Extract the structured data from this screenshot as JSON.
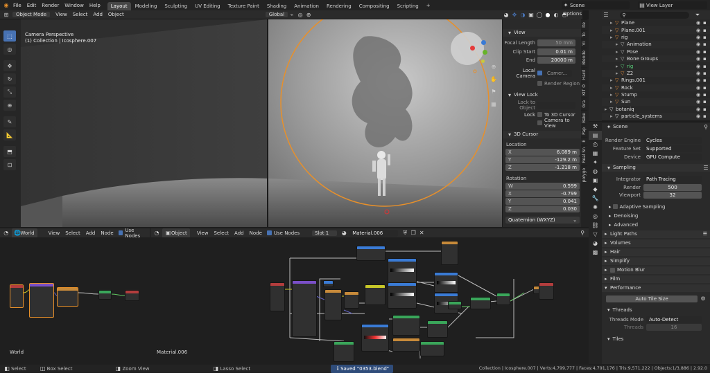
{
  "topbar": {
    "menus": [
      "File",
      "Edit",
      "Render",
      "Window",
      "Help"
    ],
    "workspaces": [
      "Layout",
      "Modeling",
      "Sculpting",
      "UV Editing",
      "Texture Paint",
      "Shading",
      "Animation",
      "Rendering",
      "Compositing",
      "Scripting"
    ],
    "active_workspace": "Layout",
    "add_tab": "+",
    "scene": "Scene",
    "view_layer": "View Layer"
  },
  "viewport": {
    "mode": "Object Mode",
    "menus": [
      "View",
      "Select",
      "Add",
      "Object"
    ],
    "transform": "Global",
    "options": "Options",
    "info_line1": "Camera Perspective",
    "info_line2": "(1) Collection | Icosphere.007"
  },
  "npanel": {
    "view_header": "View",
    "focal_length_label": "Focal Length",
    "focal_length": "50 mm",
    "clip_start_label": "Clip Start",
    "clip_start": "0.01 m",
    "end_label": "End",
    "end": "20000 m",
    "local_camera_label": "Local Camera",
    "local_camera_value": "Camer...",
    "render_region": "Render Region",
    "view_lock": "View Lock",
    "lock_to_object": "Lock to Object",
    "lock_label": "Lock",
    "to_3d_cursor": "To 3D Cursor",
    "camera_to_view": "Camera to View",
    "cursor_header": "3D Cursor",
    "location": "Location",
    "loc": [
      {
        "axis": "X",
        "value": "6.089 m"
      },
      {
        "axis": "Y",
        "value": "-129.2 m"
      },
      {
        "axis": "Z",
        "value": "-1.218 m"
      }
    ],
    "rotation": "Rotation",
    "rot": [
      {
        "axis": "W",
        "value": "0.599"
      },
      {
        "axis": "X",
        "value": "-0.799"
      },
      {
        "axis": "Y",
        "value": "0.041"
      },
      {
        "axis": "Z",
        "value": "0.030"
      }
    ],
    "rot_mode": "Quaternion (WXYZ)",
    "vtabs": [
      "Ite",
      "To",
      "Vi",
      "Blende",
      "Hard",
      "KIT O",
      "Gra",
      "Bake",
      "Pap",
      "E",
      "Real Sn",
      "polygo"
    ]
  },
  "outliner": {
    "items": [
      {
        "name": "Plane",
        "indent": 1,
        "color": "#e08a3a"
      },
      {
        "name": "Plane.001",
        "indent": 1,
        "color": "#e08a3a"
      },
      {
        "name": "rig",
        "indent": 1,
        "color": "#e08a3a"
      },
      {
        "name": "Animation",
        "indent": 2,
        "color": "#bbb"
      },
      {
        "name": "Pose",
        "indent": 2,
        "color": "#bbb"
      },
      {
        "name": "Bone Groups",
        "indent": 2,
        "color": "#bbb"
      },
      {
        "name": "rig",
        "indent": 2,
        "color": "#5ad07a"
      },
      {
        "name": "Z2",
        "indent": 2,
        "color": "#e08a3a"
      },
      {
        "name": "Rings.001",
        "indent": 1,
        "color": "#e08a3a"
      },
      {
        "name": "Rock",
        "indent": 1,
        "color": "#e08a3a"
      },
      {
        "name": "Stump",
        "indent": 1,
        "color": "#e08a3a"
      },
      {
        "name": "Sun",
        "indent": 1,
        "color": "#e08a3a"
      },
      {
        "name": "botaniq",
        "indent": 0,
        "color": "#ddd"
      },
      {
        "name": "particle_systems",
        "indent": 1,
        "color": "#ddd"
      }
    ]
  },
  "props": {
    "scene": "Scene",
    "render_engine_label": "Render Engine",
    "render_engine": "Cycles",
    "feature_set_label": "Feature Set",
    "feature_set": "Supported",
    "device_label": "Device",
    "device": "GPU Compute",
    "sampling": "Sampling",
    "integrator_label": "Integrator",
    "integrator": "Path Tracing",
    "render_label": "Render",
    "render_samples": "500",
    "viewport_label": "Viewport",
    "viewport_samples": "32",
    "adaptive": "Adaptive Sampling",
    "denoising": "Denoising",
    "advanced": "Advanced",
    "light_paths": "Light Paths",
    "volumes": "Volumes",
    "hair": "Hair",
    "simplify": "Simplify",
    "motion_blur": "Motion Blur",
    "film": "Film",
    "performance": "Performance",
    "auto_tile": "Auto Tile Size",
    "threads": "Threads",
    "threads_mode_label": "Threads Mode",
    "threads_mode": "Auto-Detect",
    "threads_label": "Threads",
    "threads_value": "16",
    "tiles": "Tiles"
  },
  "world_editor": {
    "type": "World",
    "menus": [
      "View",
      "Select",
      "Add",
      "Node"
    ],
    "use_nodes": "Use Nodes",
    "label": "World"
  },
  "shader_editor": {
    "type": "Object",
    "menus": [
      "View",
      "Select",
      "Add",
      "Node"
    ],
    "use_nodes": "Use Nodes",
    "slot": "Slot 1",
    "material": "Material.006",
    "label": "Material.006"
  },
  "statusbar": {
    "select": "Select",
    "box_select": "Box Select",
    "zoom_view": "Zoom View",
    "lasso_select": "Lasso Select",
    "saved": "Saved \"0353.blend\"",
    "stats": "Collection | Icosphere.007 | Verts:4,799,777 | Faces:4,791,176 | Tris:9,571,222 | Objects:1/3,886 | 2.92.0"
  },
  "colors": {
    "accent": "#4772b3",
    "orange": "#e8902a",
    "bg": "#1d1d1d",
    "panel": "#2b2b2b"
  }
}
